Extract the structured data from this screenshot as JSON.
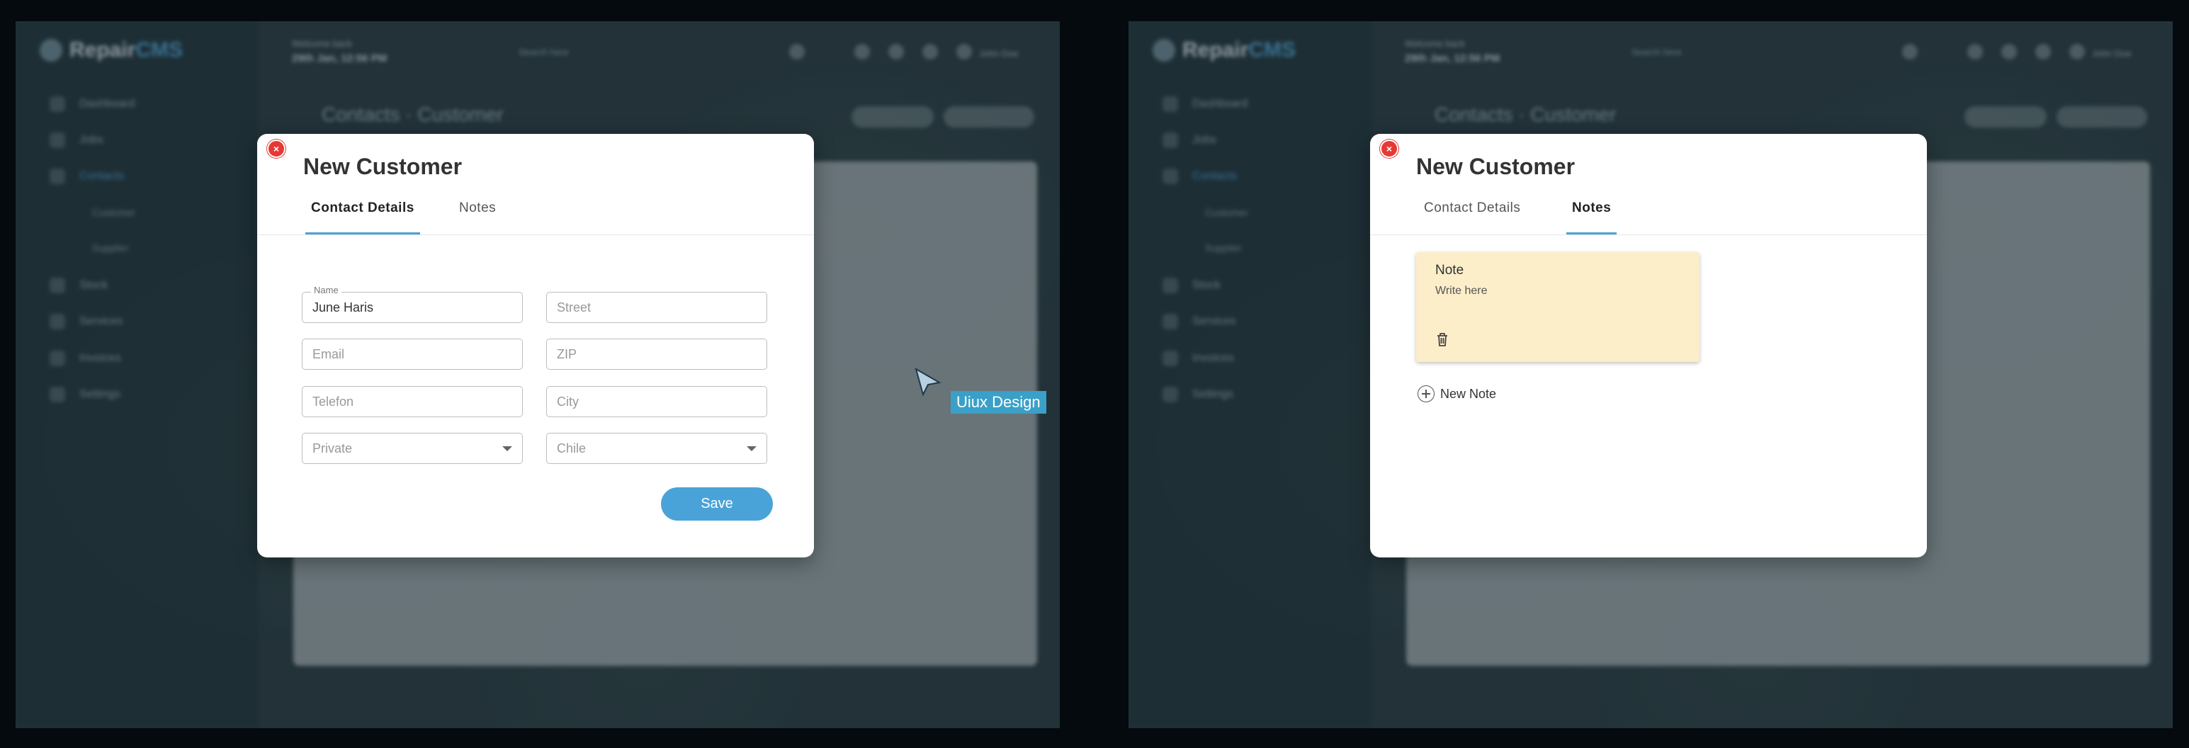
{
  "background": {
    "logo_bold": "Repair",
    "logo_accent": "CMS",
    "nav_items": [
      "Dashboard",
      "Jobs",
      "Contacts",
      "Stock",
      "Services",
      "Invoices",
      "Settings"
    ],
    "nav_sub_items": [
      "Customer",
      "Supplier"
    ],
    "date_label": "Welcome back",
    "date_value": "29th Jan, 12:56 PM",
    "search_placeholder": "Search here",
    "user_name": "John Doe",
    "breadcrumb_root": "Contacts",
    "breadcrumb_current": "Customer"
  },
  "modal_left": {
    "title": "New Customer",
    "tabs": [
      {
        "label": "Contact Details",
        "active": true
      },
      {
        "label": "Notes",
        "active": false
      }
    ],
    "fields": {
      "name_label": "Name",
      "name_value": "June Haris",
      "street_placeholder": "Street",
      "email_placeholder": "Email",
      "zip_placeholder": "ZIP",
      "telefon_placeholder": "Telefon",
      "city_placeholder": "City",
      "type_select": "Private",
      "country_select": "Chile"
    },
    "save_label": "Save"
  },
  "cursor_tag": "Uiux Design",
  "modal_right": {
    "title": "New Customer",
    "tabs": [
      {
        "label": "Contact Details",
        "active": false
      },
      {
        "label": "Notes",
        "active": true
      }
    ],
    "note": {
      "title": "Note",
      "body_placeholder": "Write here"
    },
    "new_note_label": "New Note"
  },
  "colors": {
    "accent": "#4aa3d8",
    "close": "#e53935",
    "note_bg": "#fbeec9"
  }
}
